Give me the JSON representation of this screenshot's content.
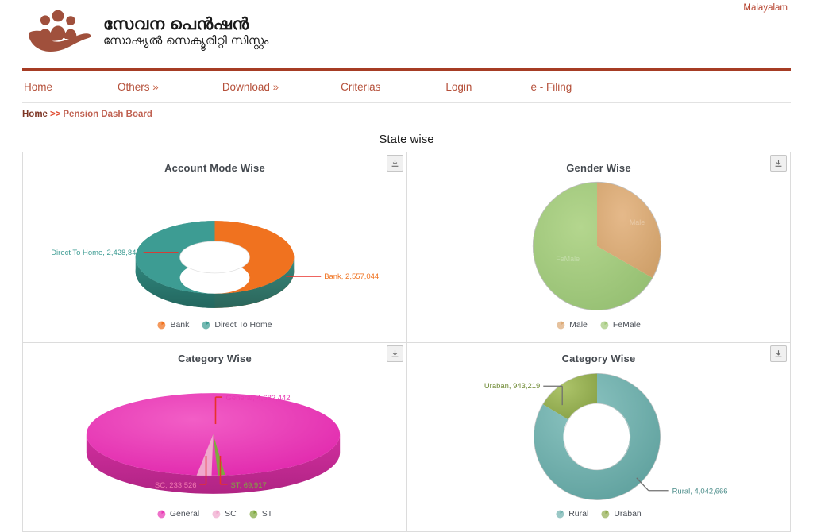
{
  "topbar": {
    "language_label": "Malayalam",
    "language_color": "#b5412c"
  },
  "header": {
    "logo_icon": "hand-holding-people-logo",
    "title": "സേവന പെൻഷൻ",
    "subtitle": "സോഷ്യൽ സെക്യൂരിറ്റി സിസ്റ്റം",
    "accent_color": "#a63c24"
  },
  "nav": {
    "items": [
      {
        "label": "Home",
        "chevron": ""
      },
      {
        "label": "Others",
        "chevron": "»"
      },
      {
        "label": "Download",
        "chevron": "»"
      },
      {
        "label": "Criterias",
        "chevron": ""
      },
      {
        "label": "Login",
        "chevron": ""
      },
      {
        "label": "e - Filing",
        "chevron": ""
      }
    ],
    "link_color": "#b5503a"
  },
  "breadcrumb": {
    "home": "Home",
    "separator": ">>",
    "current": "Pension Dash Board"
  },
  "main": {
    "section_title": "State wise",
    "export_icon": "download-export-icon"
  },
  "chart_data": [
    {
      "type": "pie",
      "variant": "donut-3d",
      "title": "Account Mode Wise",
      "categories": [
        "Bank",
        "Direct To Home"
      ],
      "values": [
        2557044,
        2428841
      ],
      "labels": [
        "Bank, 2,557,044",
        "Direct To Home, 2,428,841"
      ],
      "colors": [
        "#f0721f",
        "#3d9c93"
      ],
      "legend": [
        "Bank",
        "Direct To Home"
      ],
      "legend_position": "bottom",
      "callouts": [
        {
          "text": "Bank, 2,557,044",
          "side": "right",
          "color": "#f0721f"
        },
        {
          "text": "Direct To Home, 2,428,841",
          "side": "left",
          "color": "#3d9c93"
        }
      ]
    },
    {
      "type": "pie",
      "variant": "pie-2d",
      "title": "Gender Wise",
      "categories": [
        "Male",
        "FeMale"
      ],
      "values": [
        35,
        65
      ],
      "colors": [
        "#ddab78",
        "#a4c97c"
      ],
      "legend": [
        "Male",
        "FeMale"
      ],
      "legend_position": "bottom",
      "callouts": [
        {
          "text": "Male",
          "side": "inside",
          "color": "#ffffff"
        },
        {
          "text": "FeMale",
          "side": "inside",
          "color": "#ffffff"
        }
      ]
    },
    {
      "type": "pie",
      "variant": "pie-3d",
      "title": "Category Wise",
      "categories": [
        "General",
        "SC",
        "ST"
      ],
      "values": [
        4682442,
        233526,
        69917
      ],
      "labels": [
        "General, 4,682,442",
        "SC, 233,526",
        "ST, 69,917"
      ],
      "colors": [
        "#e83ab4",
        "#f0a8cd",
        "#7fa83f"
      ],
      "legend": [
        "General",
        "SC",
        "ST"
      ],
      "legend_position": "bottom",
      "callouts": [
        {
          "text": "General, 4,682,442",
          "side": "top",
          "color": "#e83ab4"
        },
        {
          "text": "SC, 233,526",
          "side": "bottom-left",
          "color": "#f07ab0"
        },
        {
          "text": "ST, 69,917",
          "side": "bottom-right",
          "color": "#7fa83f"
        }
      ]
    },
    {
      "type": "pie",
      "variant": "donut-2d",
      "title": "Category Wise",
      "categories": [
        "Rural",
        "Uraban"
      ],
      "values": [
        4042666,
        943219
      ],
      "labels": [
        "Rural, 4,042,666",
        "Uraban, 943,219"
      ],
      "colors": [
        "#73b3b0",
        "#93ad52"
      ],
      "legend": [
        "Rural",
        "Uraban"
      ],
      "legend_position": "bottom",
      "callouts": [
        {
          "text": "Rural, 4,042,666",
          "side": "bottom-right",
          "color": "#4a8c89"
        },
        {
          "text": "Uraban, 943,219",
          "side": "top-left",
          "color": "#6f8a34"
        }
      ]
    }
  ]
}
